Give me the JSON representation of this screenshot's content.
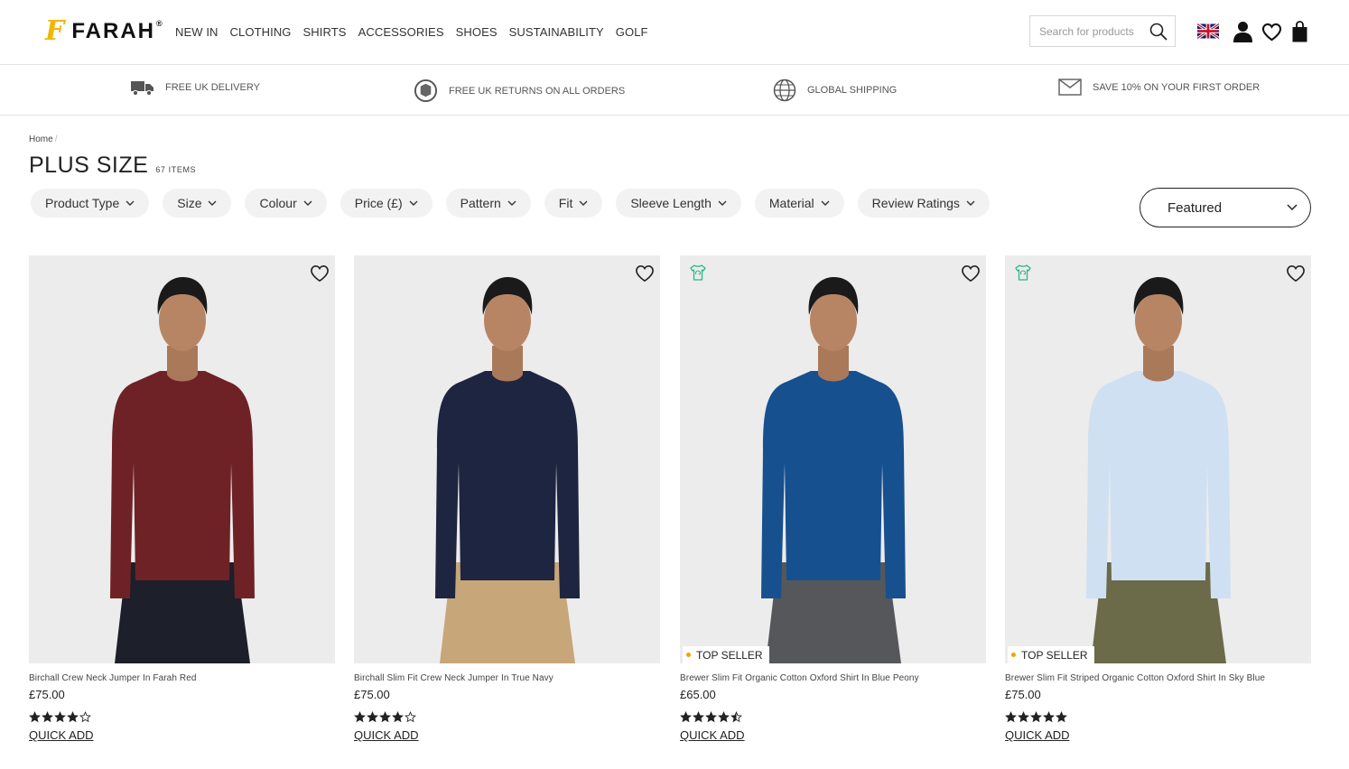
{
  "header": {
    "logo_text": "FARAH",
    "logo_mark": "F",
    "logo_reg": "®",
    "nav": [
      "NEW IN",
      "CLOTHING",
      "SHIRTS",
      "ACCESSORIES",
      "SHOES",
      "SUSTAINABILITY",
      "GOLF"
    ],
    "search_placeholder": "Search for products",
    "icons": [
      "search-icon",
      "uk-flag-icon",
      "account-icon",
      "wishlist-icon",
      "bag-icon"
    ]
  },
  "usp": [
    {
      "icon": "delivery-truck-icon",
      "label": "FREE UK DELIVERY"
    },
    {
      "icon": "returns-icon",
      "label": "FREE UK RETURNS ON ALL ORDERS"
    },
    {
      "icon": "globe-icon",
      "label": "GLOBAL SHIPPING"
    },
    {
      "icon": "envelope-icon",
      "label": "SAVE 10% ON YOUR FIRST ORDER"
    }
  ],
  "breadcrumb": {
    "home": "Home",
    "sep": "/"
  },
  "page": {
    "title": "PLUS SIZE",
    "count": "67 ITEMS"
  },
  "filters": [
    "Product Type",
    "Size",
    "Colour",
    "Price (£)",
    "Pattern",
    "Fit",
    "Sleeve Length",
    "Material",
    "Review Ratings"
  ],
  "sort": {
    "selected": "Featured"
  },
  "products": [
    {
      "name": "Birchall Crew Neck Jumper In Farah Red",
      "price": "£75.00",
      "rating": 4,
      "badge": "",
      "eco": false,
      "quick_add": "QUICK ADD",
      "garment_color": "#6e2226",
      "trouser_color": "#1d1f2a"
    },
    {
      "name": "Birchall Slim Fit Crew Neck Jumper In True Navy",
      "price": "£75.00",
      "rating": 4,
      "badge": "",
      "eco": false,
      "quick_add": "QUICK ADD",
      "garment_color": "#1e2540",
      "trouser_color": "#c7a679"
    },
    {
      "name": "Brewer Slim Fit Organic Cotton Oxford Shirt In Blue Peony",
      "price": "£65.00",
      "rating": 4.5,
      "badge": "TOP SELLER",
      "eco": true,
      "quick_add": "QUICK ADD",
      "garment_color": "#17508f",
      "trouser_color": "#56575b"
    },
    {
      "name": "Brewer Slim Fit Striped Organic Cotton Oxford Shirt In Sky Blue",
      "price": "£75.00",
      "rating": 5,
      "badge": "TOP SELLER",
      "eco": true,
      "quick_add": "QUICK ADD",
      "garment_color": "#cfe0f2",
      "trouser_color": "#6b6a49"
    }
  ],
  "colors": {
    "accent": "#f2b705",
    "eco": "#2bb58a",
    "badge_dot": "#f2a400"
  }
}
